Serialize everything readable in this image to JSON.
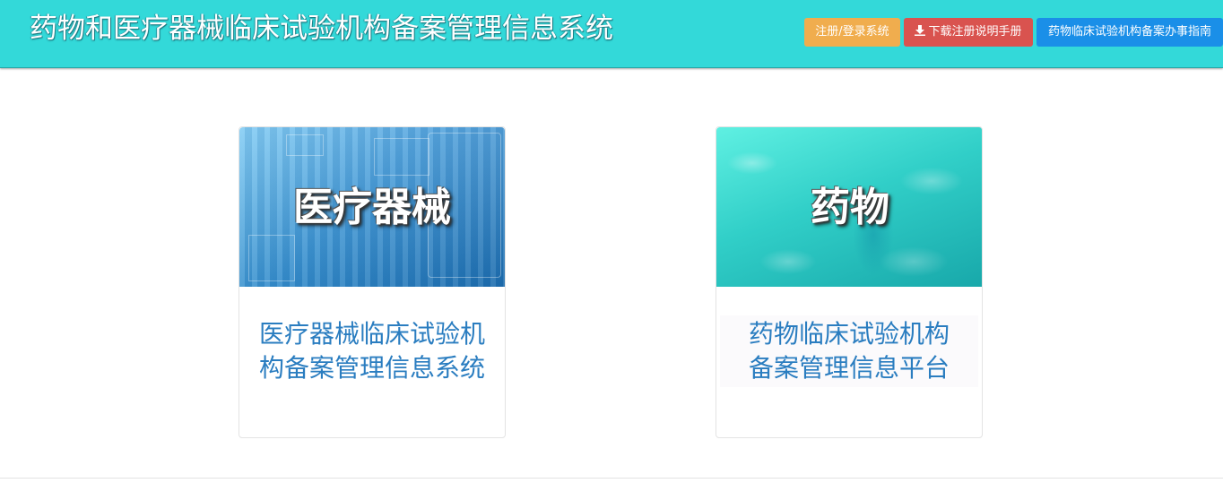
{
  "header": {
    "title": "药物和医疗器械临床试验机构备案管理信息系统",
    "buttons": {
      "login": "注册/登录系统",
      "download": "下载注册说明手册",
      "guide": "药物临床试验机构备案办事指南"
    }
  },
  "cards": {
    "device": {
      "banner_text": "医疗器械",
      "title_line1": "医疗器械临床试验机",
      "title_line2": "构备案管理信息系统"
    },
    "drug": {
      "banner_text": "药物",
      "title_line1": "药物临床试验机构",
      "title_line2": "备案管理信息平台"
    }
  },
  "colors": {
    "header_bg": "#33d9d9",
    "login_btn": "#f0ad4e",
    "download_btn": "#d9534f",
    "guide_btn": "#1a8fe8",
    "card_title": "#2a7dc0"
  }
}
